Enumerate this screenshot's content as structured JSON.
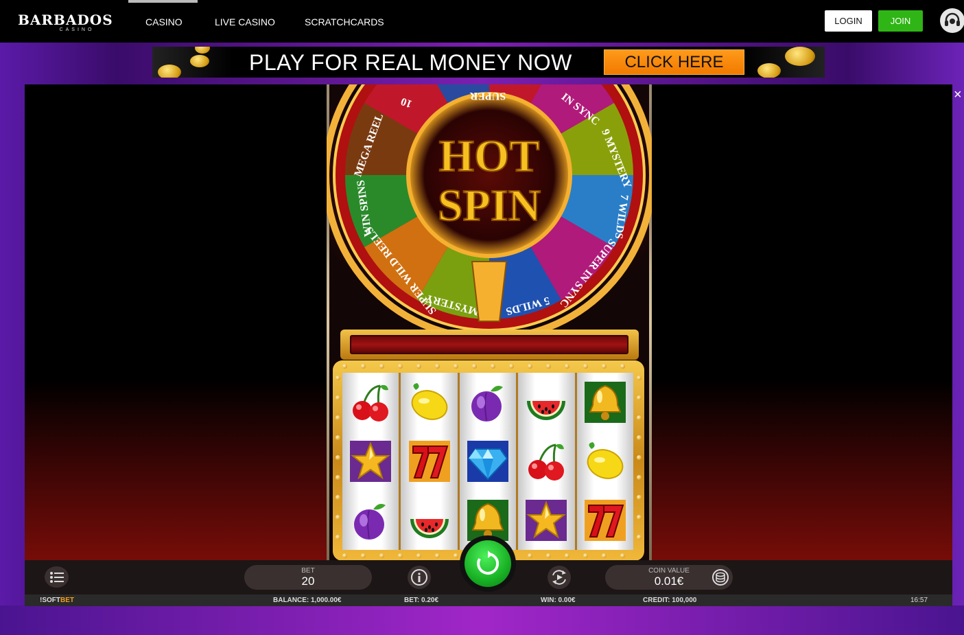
{
  "site": {
    "logo_main": "BARBADOS",
    "logo_sub": "CASINO"
  },
  "nav": {
    "items": [
      "CASINO",
      "LIVE CASINO",
      "SCRATCHCARDS"
    ],
    "login_label": "LOGIN",
    "join_label": "JOIN"
  },
  "banner": {
    "text": "PLAY FOR REAL MONEY NOW",
    "cta": "CLICK HERE"
  },
  "game": {
    "wheel_center_line1": "HOT",
    "wheel_center_line2": "SPIN",
    "wheel_segments": [
      "10",
      "SUPER",
      "IN SYNC",
      "9 MYSTERY",
      "7 WILDS",
      "SUPER IN SYNC",
      "5 WILDS",
      "8 MYSTERY",
      "SUPER WILD REELS",
      "WIN SPINS",
      "MEGA REEL",
      "HOT"
    ],
    "reels": [
      [
        "cherry",
        "star",
        "plum"
      ],
      [
        "lemon",
        "seven",
        "watermelon"
      ],
      [
        "plum",
        "diamond",
        "bell"
      ],
      [
        "watermelon",
        "cherry",
        "star"
      ],
      [
        "bell",
        "lemon",
        "seven"
      ]
    ],
    "close_label": "×"
  },
  "controls": {
    "bet_label": "BET",
    "bet_value": "20",
    "coin_value_label": "COIN VALUE",
    "coin_value": "0.01€"
  },
  "info_bar": {
    "provider_prefix": "!SOFT",
    "provider_suffix": "BET",
    "balance": "BALANCE:  1,000.00€",
    "bet": "BET:  0.20€",
    "win": "WIN:  0.00€",
    "credit": "CREDIT:  100,000",
    "time": "16:57"
  },
  "colors": {
    "join_green": "#2fb515",
    "cta_orange": "#f07a00",
    "spin_green": "#18b024"
  }
}
